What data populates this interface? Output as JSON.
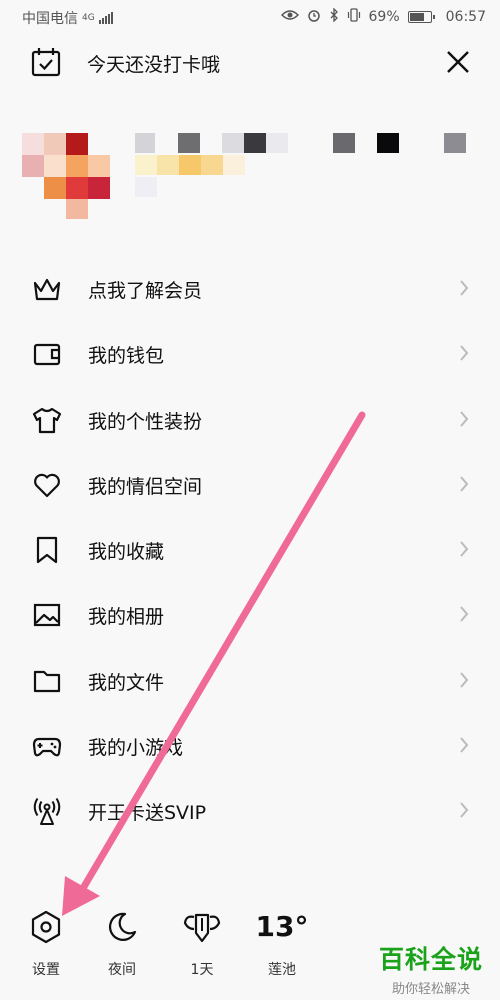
{
  "status_bar": {
    "carrier": "中国电信",
    "network": "4G",
    "battery": "69%",
    "time": "06:57"
  },
  "header": {
    "title": "今天还没打卡哦",
    "calendar_icon": "calendar-check-icon",
    "close_icon": "close-icon"
  },
  "menu": {
    "items": [
      {
        "label": "点我了解会员",
        "icon": "crown-icon"
      },
      {
        "label": "我的钱包",
        "icon": "wallet-icon"
      },
      {
        "label": "我的个性装扮",
        "icon": "tshirt-icon"
      },
      {
        "label": "我的情侣空间",
        "icon": "heart-icon"
      },
      {
        "label": "我的收藏",
        "icon": "bookmark-icon"
      },
      {
        "label": "我的相册",
        "icon": "image-icon"
      },
      {
        "label": "我的文件",
        "icon": "folder-icon"
      },
      {
        "label": "我的小游戏",
        "icon": "gamepad-icon"
      },
      {
        "label": "开王卡送SVIP",
        "icon": "signal-tower-icon"
      }
    ]
  },
  "bottom_bar": {
    "settings_label": "设置",
    "night_label": "夜间",
    "days_label": "1天",
    "temperature": "13°",
    "location": "莲池"
  },
  "watermark": {
    "main": "百科全说",
    "sub": "助你轻松解决"
  },
  "colors": {
    "background": "#f8f8f8",
    "arrow": "#f06a98",
    "watermark": "#1aa31a"
  }
}
